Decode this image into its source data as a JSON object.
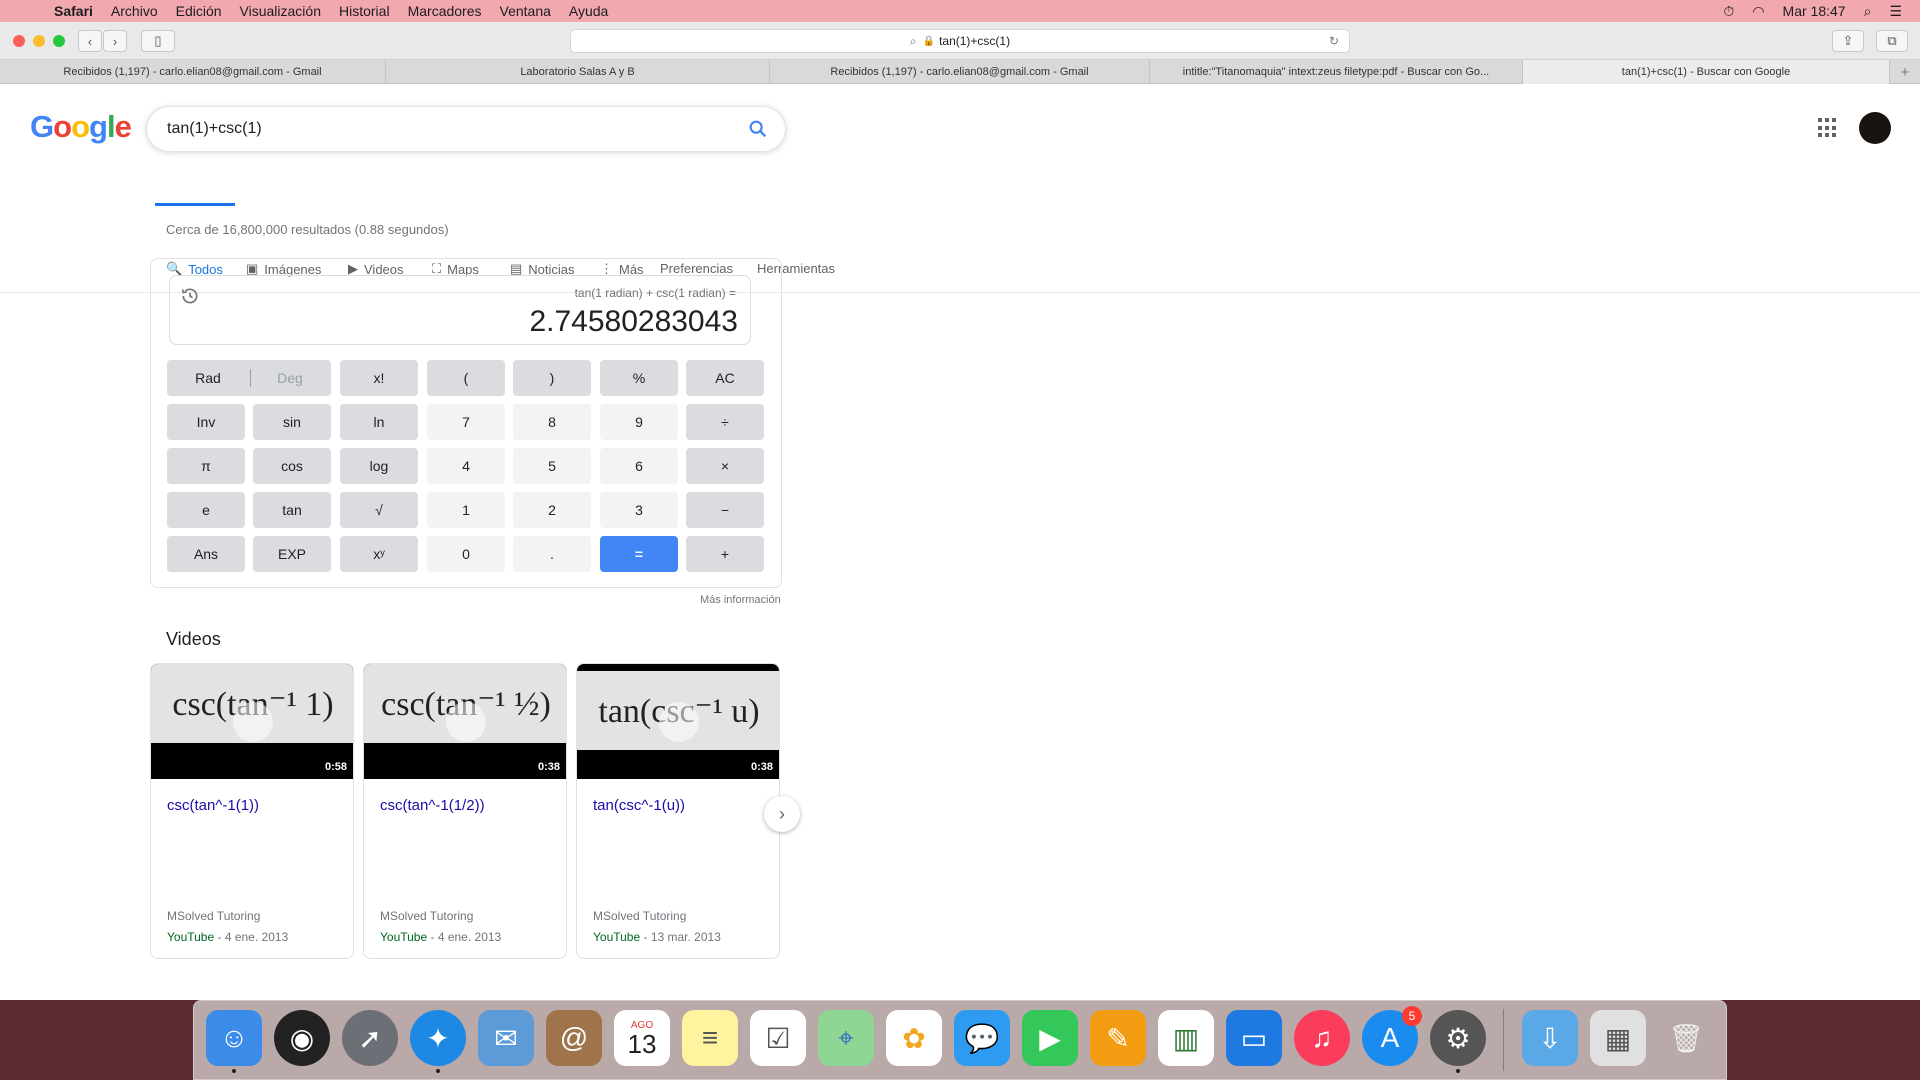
{
  "menubar": {
    "app": "Safari",
    "items": [
      "Archivo",
      "Edición",
      "Visualización",
      "Historial",
      "Marcadores",
      "Ventana",
      "Ayuda"
    ],
    "clock": "Mar 18:47"
  },
  "browser": {
    "url": "tan(1)+csc(1)",
    "tabs": [
      {
        "label": "Recibidos (1,197) - carlo.elian08@gmail.com - Gmail"
      },
      {
        "label": "Laboratorio Salas A y B"
      },
      {
        "label": "Recibidos (1,197) - carlo.elian08@gmail.com - Gmail"
      },
      {
        "label": "intitle:\"Titanomaquia\" intext:zeus filetype:pdf - Buscar con Go..."
      },
      {
        "label": "tan(1)+csc(1) - Buscar con Google"
      }
    ],
    "new_tab": "+"
  },
  "google": {
    "logo_letters": [
      "G",
      "o",
      "o",
      "g",
      "l",
      "e"
    ],
    "logo_colors": [
      "#4285f4",
      "#ea4335",
      "#fbbc05",
      "#4285f4",
      "#34a853",
      "#ea4335"
    ],
    "query": "tan(1)+csc(1)",
    "nav": [
      {
        "label": "Todos",
        "icon": "🔍"
      },
      {
        "label": "Imágenes",
        "icon": "▣"
      },
      {
        "label": "Videos",
        "icon": "▶"
      },
      {
        "label": "Maps",
        "icon": "⛶"
      },
      {
        "label": "Noticias",
        "icon": "▤"
      },
      {
        "label": "Más",
        "icon": "⋮"
      },
      {
        "label": "Preferencias",
        "icon": ""
      },
      {
        "label": "Herramientas",
        "icon": ""
      }
    ],
    "stats": "Cerca de 16,800,000 resultados (0.88 segundos)",
    "accent": "#1a73e8"
  },
  "calculator": {
    "expression": "tan(1 radian) + csc(1 radian) =",
    "result": "2.74580283043",
    "rad": "Rad",
    "deg": "Deg",
    "keys": [
      [
        "x!",
        "(",
        ")",
        "%",
        "AC"
      ],
      [
        "Inv",
        "sin",
        "ln",
        "7",
        "8",
        "9",
        "÷"
      ],
      [
        "π",
        "cos",
        "log",
        "4",
        "5",
        "6",
        "×"
      ],
      [
        "e",
        "tan",
        "√",
        "1",
        "2",
        "3",
        "−"
      ],
      [
        "Ans",
        "EXP",
        "xʸ",
        "0",
        ".",
        "=",
        "+"
      ]
    ],
    "more_info": "Más información"
  },
  "videos": {
    "heading": "Videos",
    "items": [
      {
        "thumb": "csc(tan⁻¹ 1)",
        "duration": "0:58",
        "title": "csc(tan^-1(1))",
        "channel": "MSolved Tutoring",
        "source": "YouTube",
        "date": "- 4 ene. 2013"
      },
      {
        "thumb": "csc(tan⁻¹ ½)",
        "duration": "0:38",
        "title": "csc(tan^-1(1/2))",
        "channel": "MSolved Tutoring",
        "source": "YouTube",
        "date": "- 4 ene. 2013"
      },
      {
        "thumb": "tan(csc⁻¹ u)",
        "duration": "0:38",
        "title": "tan(csc^-1(u))",
        "channel": "MSolved Tutoring",
        "source": "YouTube",
        "date": "- 13 mar. 2013"
      }
    ],
    "next": "›"
  },
  "dock": {
    "icons": [
      "finder-icon",
      "siri-icon",
      "launchpad-icon",
      "safari-icon",
      "mail-icon",
      "contacts-icon",
      "calendar-icon",
      "notes-icon",
      "reminders-icon",
      "maps-icon",
      "photos-icon",
      "messages-icon",
      "facetime-icon",
      "pages-icon",
      "numbers-icon",
      "keynote-icon",
      "music-icon",
      "app-store-icon",
      "system-preferences-icon",
      "downloads-folder-icon",
      "preview-icon",
      "trash-icon"
    ],
    "calendar_month": "AGO",
    "calendar_day": "13",
    "app_store_badge": "5"
  }
}
